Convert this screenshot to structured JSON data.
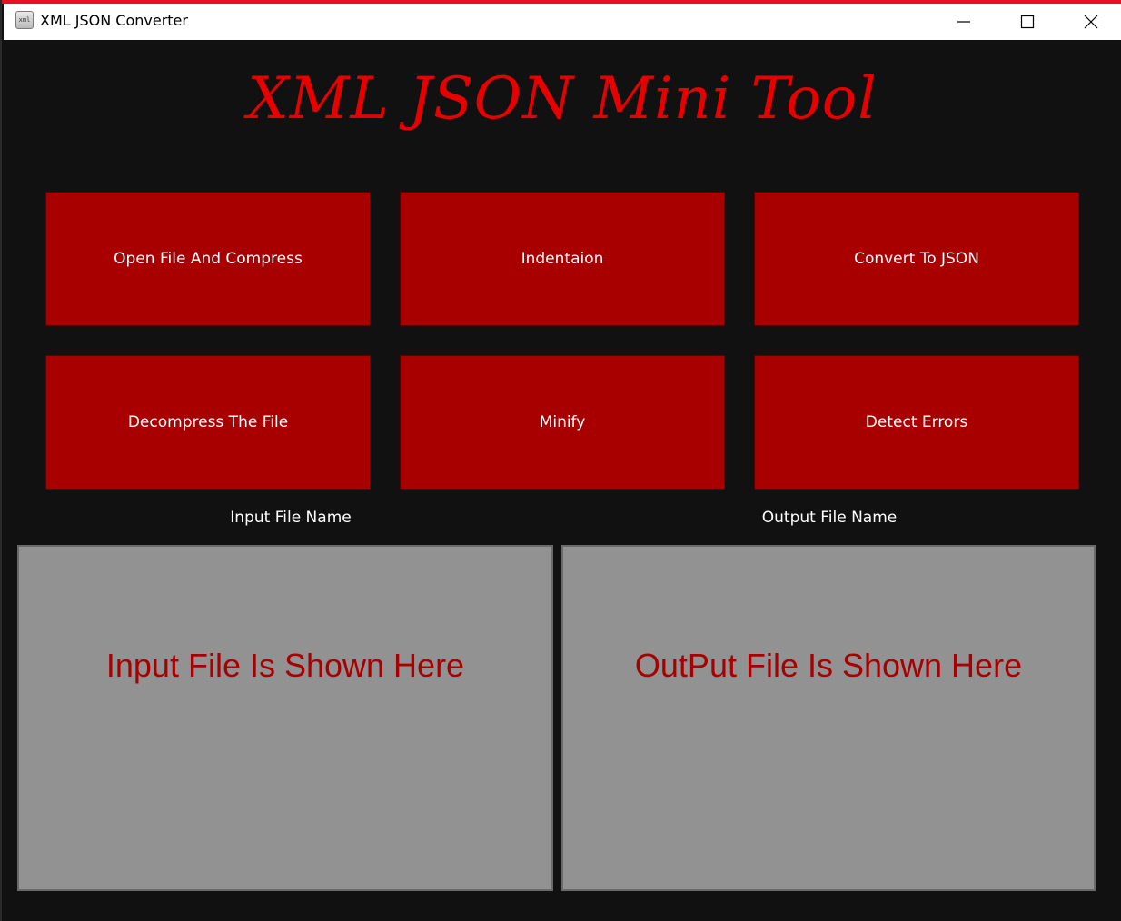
{
  "window": {
    "title": "XML JSON Converter",
    "app_icon": "xml-file-icon",
    "app_icon_text": "xml",
    "controls": [
      "minimize-icon",
      "maximize-icon",
      "close-icon"
    ]
  },
  "header": {
    "title": "XML JSON Mini Tool",
    "color": "#e60000"
  },
  "actions": {
    "open_compress": "Open File And Compress",
    "indentation": "Indentaion",
    "convert_json": "Convert To JSON",
    "decompress": "Decompress The File",
    "minify": "Minify",
    "detect_errors": "Detect Errors",
    "button_color": "#a80000"
  },
  "input": {
    "label": "Input File Name",
    "placeholder": "Input File Is Shown Here"
  },
  "output": {
    "label": "Output File Name",
    "placeholder": "OutPut File Is Shown Here"
  },
  "theme": {
    "background": "#111111",
    "panel": "#929292",
    "panel_text": "#a80000"
  }
}
